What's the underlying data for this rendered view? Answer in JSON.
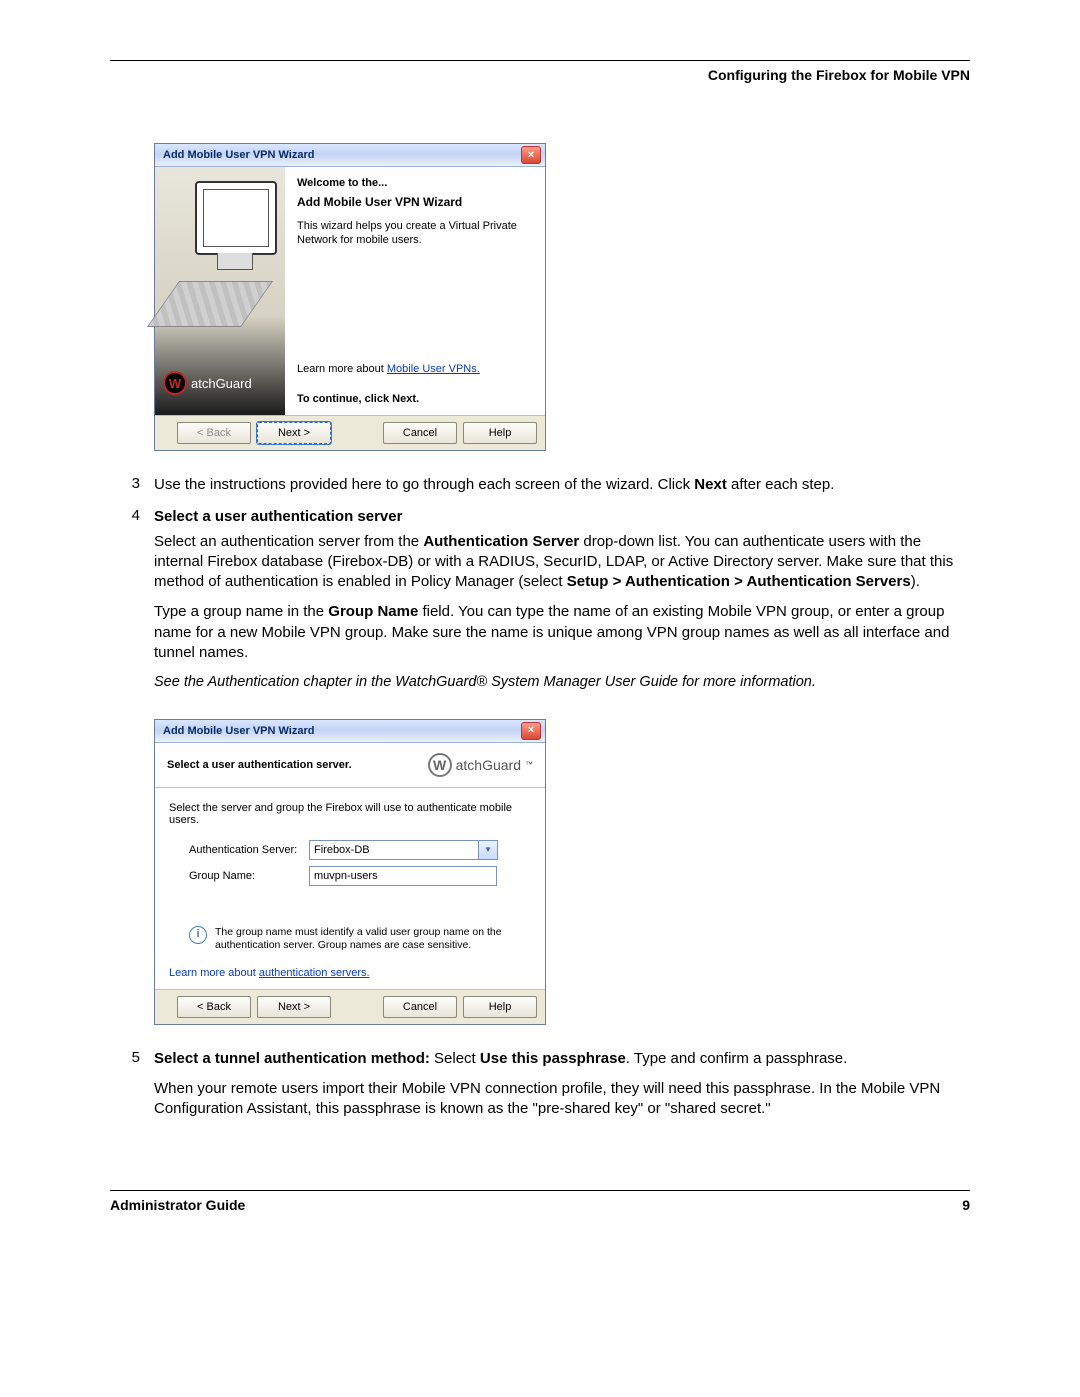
{
  "header": {
    "section_title": "Configuring the Firebox for Mobile VPN"
  },
  "wizard1": {
    "title": "Add Mobile User VPN Wizard",
    "welcome": "Welcome to the...",
    "subtitle": "Add Mobile User VPN Wizard",
    "description": "This wizard helps you create a Virtual Private Network for mobile users.",
    "learn_prefix": "Learn more about ",
    "learn_link": "Mobile User VPNs.",
    "continue": "To continue, click Next.",
    "brand": "atchGuard",
    "buttons": {
      "back": "< Back",
      "next": "Next >",
      "cancel": "Cancel",
      "help": "Help"
    }
  },
  "step3": {
    "num": "3",
    "text_before": "Use the instructions provided here to go through each screen of the wizard. Click ",
    "text_bold": "Next",
    "text_after": " after each step."
  },
  "step4": {
    "num": "4",
    "heading": "Select a user authentication server",
    "p1_a": "Select an authentication server from the ",
    "p1_b": "Authentication Server",
    "p1_c": " drop-down list. You can authenticate users with the internal Firebox database (Firebox-DB) or with a RADIUS, SecurID, LDAP, or Active Directory server. Make sure that this method of authentication is enabled in Policy Manager (select ",
    "p1_d": "Setup > Authentication > Authentication Servers",
    "p1_e": ").",
    "p2_a": "Type a group name in the ",
    "p2_b": "Group Name",
    "p2_c": " field. You can type the name of an existing Mobile VPN group, or enter a group name for a new Mobile VPN group. Make sure the name is unique among VPN group names as well as all interface and tunnel names.",
    "note": "See the Authentication chapter in the WatchGuard® System Manager User Guide for more information."
  },
  "wizard2": {
    "title": "Add Mobile User VPN Wizard",
    "panel_title": "Select a user authentication server.",
    "brand": "atchGuard",
    "instruction": "Select the server and group the Firebox will use to authenticate mobile users.",
    "auth_label": "Authentication Server:",
    "auth_value": "Firebox-DB",
    "group_label": "Group Name:",
    "group_value": "muvpn-users",
    "info_text": "The group name must identify a valid user group name on the authentication server. Group names are case sensitive.",
    "learn_prefix": "Learn more about ",
    "learn_link": "authentication servers.",
    "buttons": {
      "back": "< Back",
      "next": "Next >",
      "cancel": "Cancel",
      "help": "Help"
    }
  },
  "step5": {
    "num": "5",
    "h_a": "Select a tunnel authentication method:",
    "h_b": " Select ",
    "h_c": "Use this passphrase",
    "h_d": ". Type and confirm a passphrase.",
    "p2": "When your remote users import their Mobile VPN connection profile, they will need this passphrase. In the Mobile VPN Configuration Assistant, this passphrase is known as the \"pre-shared key\" or \"shared secret.\""
  },
  "footer": {
    "left": "Administrator Guide",
    "right": "9"
  }
}
